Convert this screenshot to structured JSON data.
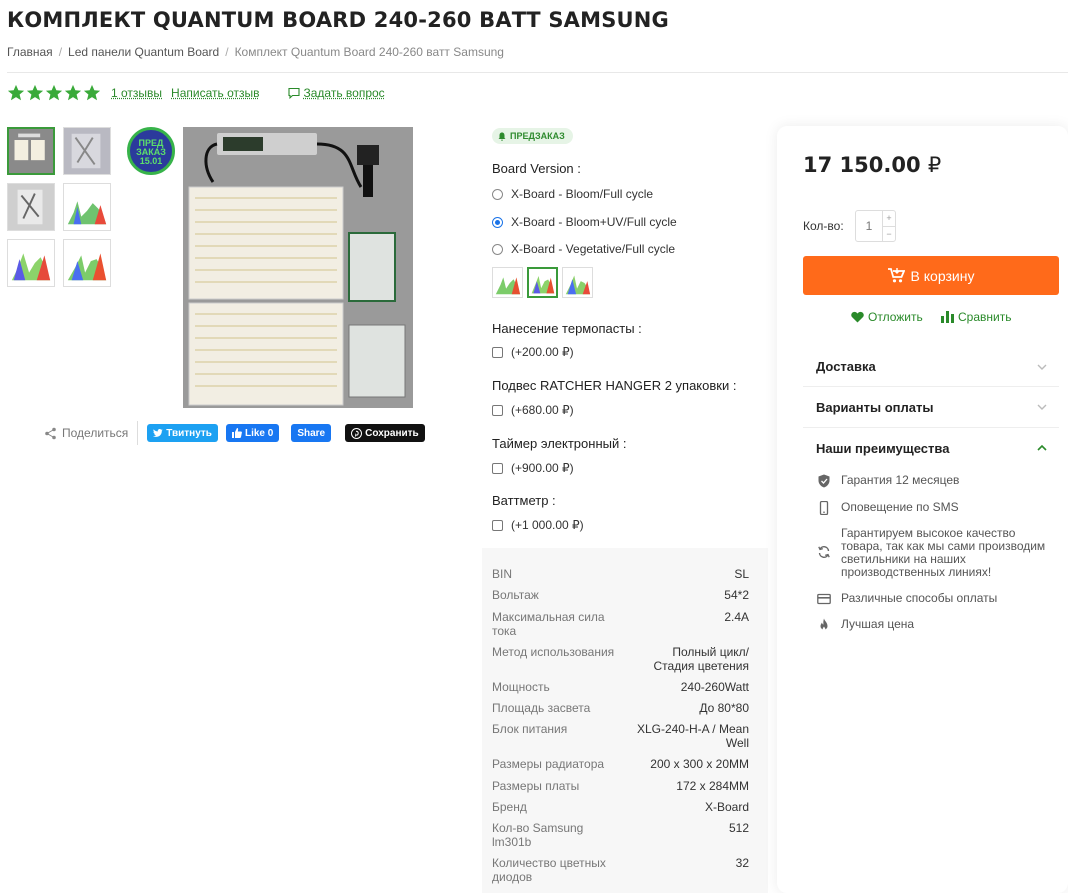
{
  "product": {
    "title": "КОМПЛЕКТ QUANTUM BOARD 240-260 ВАТТ SAMSUNG",
    "breadcrumbs": [
      "Главная",
      "Led панели Quantum Board",
      "Комплект Quantum Board 240-260 ватт Samsung"
    ],
    "rating_stars": 5,
    "reviews_link": "1 отзывы",
    "write_review": "Написать отзыв",
    "ask_question": "Задать вопрос",
    "preorder_badge": "ПРЕД ЗАКАЗ 15.01",
    "preorder_tag": "ПРЕДЗАКАЗ"
  },
  "share": {
    "label": "Поделиться",
    "twitter": "Твитнуть",
    "fb_like": "Like 0",
    "fb_share": "Share",
    "pinterest": "Сохранить"
  },
  "options": {
    "board_version": {
      "title": "Board Version :",
      "items": [
        "X-Board - Bloom/Full cycle",
        "X-Board - Bloom+UV/Full cycle",
        "X-Board - Vegetative/Full cycle"
      ],
      "selected_index": 1
    },
    "thermal_paste": {
      "title": "Нанесение термопасты :",
      "label": "(+200.00 ₽)"
    },
    "hanger": {
      "title": "Подвес RATCHER HANGER 2 упаковки :",
      "label": "(+680.00 ₽)"
    },
    "timer": {
      "title": "Таймер электронный :",
      "label": "(+900.00 ₽)"
    },
    "wattmeter": {
      "title": "Ваттметр :",
      "label": "(+1 000.00 ₽)"
    }
  },
  "specs": [
    {
      "k": "BIN",
      "v": "SL"
    },
    {
      "k": "Вольтаж",
      "v": "54*2"
    },
    {
      "k": "Максимальная сила тока",
      "v": "2.4A"
    },
    {
      "k": "Метод использования",
      "v": "Полный цикл/Стадия цветения"
    },
    {
      "k": "Мощность",
      "v": "240-260Watt"
    },
    {
      "k": "Площадь засвета",
      "v": "До 80*80"
    },
    {
      "k": "Блок питания",
      "v": "XLG-240-H-A / Mean Well"
    },
    {
      "k": "Размеры радиатора",
      "v": "200 x 300 x 20MM"
    },
    {
      "k": "Размеры платы",
      "v": "172 x 284MM"
    },
    {
      "k": "Бренд",
      "v": "X-Board"
    },
    {
      "k": "Кол-во Samsung lm301b",
      "v": "512"
    },
    {
      "k": "Количество цветных диодов",
      "v": "32"
    }
  ],
  "buy": {
    "price": "17 150.00",
    "currency": "₽",
    "qty_label": "Кол-во:",
    "qty_value": "1",
    "plus": "+",
    "minus": "−",
    "cart_button": "В корзину",
    "wishlist": "Отложить",
    "compare": "Сравнить"
  },
  "accordion": {
    "delivery": "Доставка",
    "payment": "Варианты оплаты",
    "advantages": "Наши преимущества"
  },
  "advantages": [
    {
      "icon": "shield-icon",
      "text": "Гарантия 12 месяцев"
    },
    {
      "icon": "phone-icon",
      "text": "Оповещение по SMS"
    },
    {
      "icon": "refresh-icon",
      "text": "Гарантируем высокое качество товара, так как мы сами производим светильники на наших производственных линиях!"
    },
    {
      "icon": "card-icon",
      "text": "Различные способы оплаты"
    },
    {
      "icon": "fire-icon",
      "text": "Лучшая цена"
    }
  ],
  "colors": {
    "accent_green": "#2a8a2a",
    "cart_orange": "#ff6a1a",
    "star_green": "#3aaa3a",
    "radio_blue": "#1a73e8"
  }
}
